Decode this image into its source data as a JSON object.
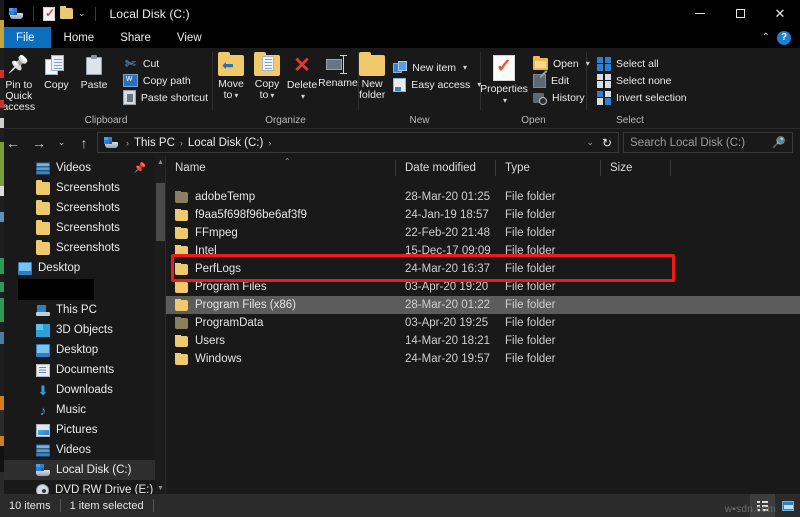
{
  "window": {
    "title": "Local Disk (C:)",
    "controls": {
      "minimize": "─",
      "maximize": "□",
      "close": "✕"
    },
    "quick_access": {
      "drive_icon": "drive-icon",
      "properties_icon": "properties-icon",
      "new_folder_icon": "new-folder-icon",
      "customize_caret": "⌄"
    }
  },
  "ribbon": {
    "tabs": [
      {
        "label": "File",
        "active_file": true
      },
      {
        "label": "Home",
        "active": true
      },
      {
        "label": "Share"
      },
      {
        "label": "View"
      }
    ],
    "collapse_chevron": "⌃",
    "help_label": "?",
    "groups": [
      {
        "name": "Clipboard",
        "label": "Clipboard",
        "big_buttons": [
          {
            "label": "Pin to Quick access",
            "icon": "pin-icon"
          },
          {
            "label": "Copy",
            "icon": "copy-icon"
          },
          {
            "label": "Paste",
            "icon": "paste-icon"
          }
        ],
        "small_buttons": [
          {
            "label": "Cut",
            "icon": "scissors-icon"
          },
          {
            "label": "Copy path",
            "icon": "copy-path-icon"
          },
          {
            "label": "Paste shortcut",
            "icon": "paste-shortcut-icon"
          }
        ]
      },
      {
        "name": "Organize",
        "label": "Organize",
        "big_buttons": [
          {
            "label": "Move to",
            "icon": "move-to-icon",
            "caret": "▾"
          },
          {
            "label": "Copy to",
            "icon": "copy-to-icon",
            "caret": "▾"
          },
          {
            "label": "Delete",
            "icon": "delete-icon",
            "caret": "▾"
          },
          {
            "label": "Rename",
            "icon": "rename-icon"
          }
        ]
      },
      {
        "name": "New",
        "label": "New",
        "big_buttons": [
          {
            "label": "New folder",
            "icon": "new-folder-icon"
          }
        ],
        "small_buttons": [
          {
            "label": "New item",
            "icon": "new-item-icon",
            "caret": "▾"
          },
          {
            "label": "Easy access",
            "icon": "easy-access-icon",
            "caret": "▾"
          }
        ]
      },
      {
        "name": "Open",
        "label": "Open",
        "big_buttons": [
          {
            "label": "Properties",
            "icon": "properties-icon",
            "caret": "▾"
          }
        ],
        "small_buttons": [
          {
            "label": "Open",
            "icon": "open-folder-icon",
            "caret": "▾"
          },
          {
            "label": "Edit",
            "icon": "edit-icon"
          },
          {
            "label": "History",
            "icon": "history-icon"
          }
        ]
      },
      {
        "name": "Select",
        "label": "Select",
        "small_buttons": [
          {
            "label": "Select all",
            "icon": "select-all-icon"
          },
          {
            "label": "Select none",
            "icon": "select-none-icon"
          },
          {
            "label": "Invert selection",
            "icon": "invert-selection-icon"
          }
        ]
      }
    ]
  },
  "address_bar": {
    "back": "←",
    "forward": "→",
    "recent": "⌄",
    "up": "↑",
    "breadcrumbs": [
      "This PC",
      "Local Disk (C:)"
    ],
    "separator": "›",
    "dropdown": "⌄",
    "refresh": "↻"
  },
  "search": {
    "placeholder": "Search Local Disk (C:)",
    "icon": "search-icon"
  },
  "sidebar": {
    "items": [
      {
        "label": "Videos",
        "icon": "videos-icon",
        "indent": 1,
        "pinned": true
      },
      {
        "label": "Screenshots",
        "icon": "folder-icon",
        "indent": 2
      },
      {
        "label": "Screenshots",
        "icon": "folder-icon",
        "indent": 2
      },
      {
        "label": "Screenshots",
        "icon": "folder-icon",
        "indent": 2
      },
      {
        "label": "Screenshots",
        "icon": "folder-icon",
        "indent": 2
      },
      {
        "label": "Desktop",
        "icon": "desktop-icon",
        "indent": 0
      },
      {
        "label": "",
        "icon": "redacted",
        "indent": 0,
        "redacted": true
      },
      {
        "label": "This PC",
        "icon": "this-pc-icon",
        "indent": 0
      },
      {
        "label": "3D Objects",
        "icon": "3d-objects-icon",
        "indent": 1
      },
      {
        "label": "Desktop",
        "icon": "desktop-icon",
        "indent": 1
      },
      {
        "label": "Documents",
        "icon": "documents-icon",
        "indent": 1
      },
      {
        "label": "Downloads",
        "icon": "downloads-icon",
        "indent": 1
      },
      {
        "label": "Music",
        "icon": "music-icon",
        "indent": 1
      },
      {
        "label": "Pictures",
        "icon": "pictures-icon",
        "indent": 1
      },
      {
        "label": "Videos",
        "icon": "videos-icon",
        "indent": 1
      },
      {
        "label": "Local Disk (C:)",
        "icon": "local-disk-icon",
        "indent": 1,
        "selected": true
      },
      {
        "label": "DVD RW Drive (E:)",
        "icon": "dvd-drive-icon",
        "indent": 1
      }
    ]
  },
  "file_list": {
    "columns": [
      {
        "label": "Name",
        "sorted": "asc",
        "sort_glyph": "⌃"
      },
      {
        "label": "Date modified"
      },
      {
        "label": "Type"
      },
      {
        "label": "Size"
      }
    ],
    "rows": [
      {
        "name": "adobeTemp",
        "date": "28-Mar-20 01:25",
        "type": "File folder",
        "size": "",
        "hidden_attr": true
      },
      {
        "name": "f9aa5f698f96be6af3f9",
        "date": "24-Jan-19 18:57",
        "type": "File folder",
        "size": ""
      },
      {
        "name": "FFmpeg",
        "date": "22-Feb-20 21:48",
        "type": "File folder",
        "size": ""
      },
      {
        "name": "Intel",
        "date": "15-Dec-17 09:09",
        "type": "File folder",
        "size": ""
      },
      {
        "name": "PerfLogs",
        "date": "24-Mar-20 16:37",
        "type": "File folder",
        "size": ""
      },
      {
        "name": "Program Files",
        "date": "03-Apr-20 19:20",
        "type": "File folder",
        "size": ""
      },
      {
        "name": "Program Files (x86)",
        "date": "28-Mar-20 01:22",
        "type": "File folder",
        "size": "",
        "selected": true,
        "annotated": true
      },
      {
        "name": "ProgramData",
        "date": "03-Apr-20 19:25",
        "type": "File folder",
        "size": "",
        "hidden_attr": true
      },
      {
        "name": "Users",
        "date": "14-Mar-20 18:21",
        "type": "File folder",
        "size": ""
      },
      {
        "name": "Windows",
        "date": "24-Mar-20 19:57",
        "type": "File folder",
        "size": ""
      }
    ]
  },
  "status_bar": {
    "item_count": "10 items",
    "selection": "1 item selected",
    "view_buttons": [
      {
        "name": "details-view",
        "active": true
      },
      {
        "name": "large-icons-view",
        "active": false
      }
    ]
  },
  "watermark": {
    "text": "w▪sdn.com"
  },
  "colors": {
    "accent_blue": "#0d6ebe",
    "annotation_red": "#ee1b1b",
    "selection_grey": "#5c5c5c",
    "folder_yellow": "#eec96f",
    "window_bg": "#191919"
  }
}
